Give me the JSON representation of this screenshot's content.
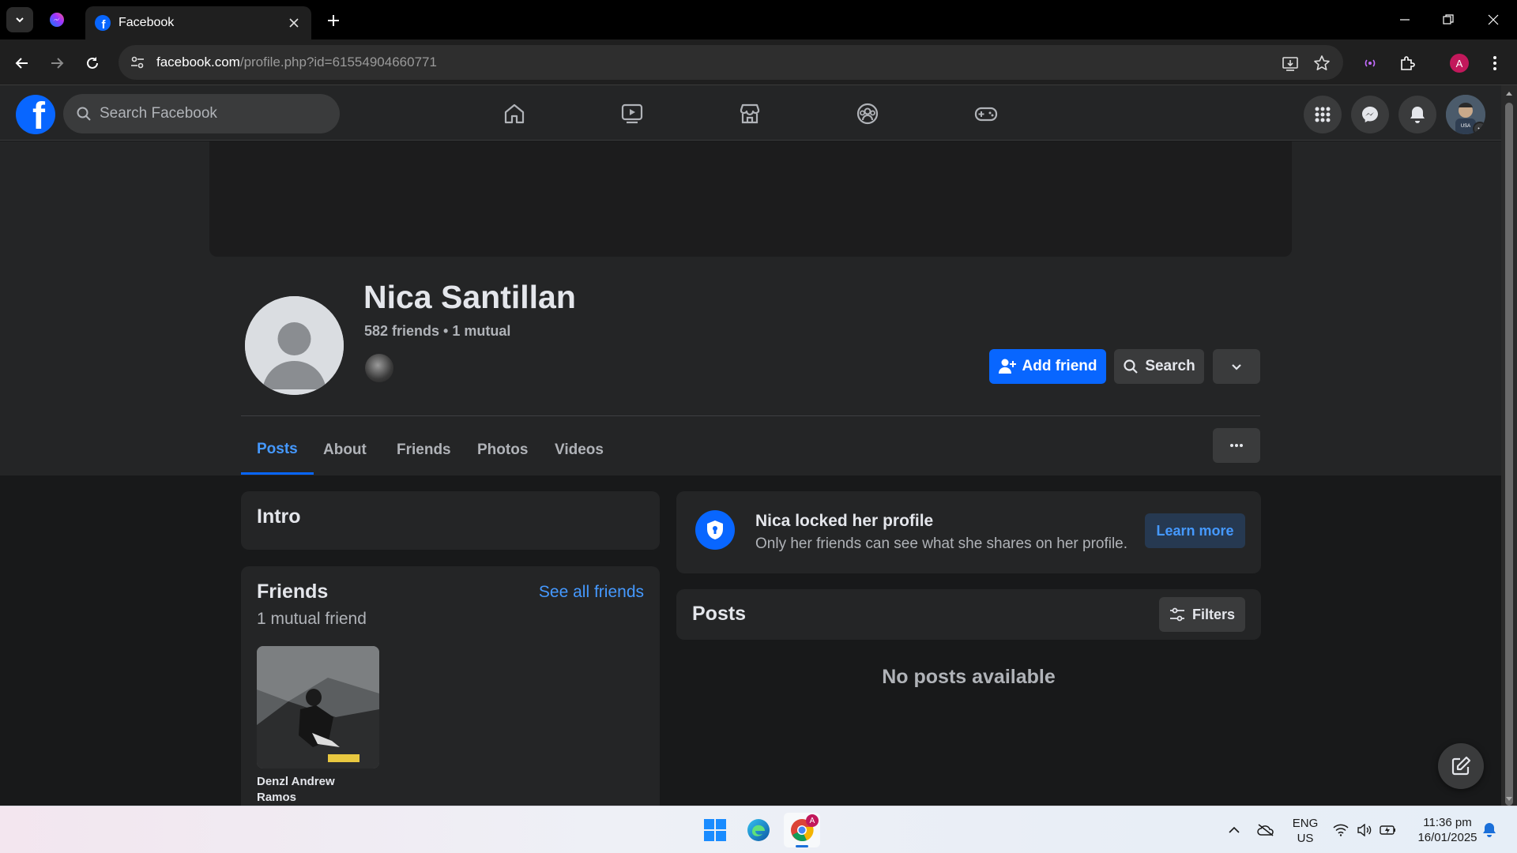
{
  "browser": {
    "tab_title": "Facebook",
    "url_host": "facebook.com",
    "url_path": "/profile.php?id=61554904660771",
    "profile_initial": "A"
  },
  "header": {
    "search_placeholder": "Search Facebook"
  },
  "profile": {
    "name": "Nica Santillan",
    "friend_summary": "582 friends • 1 mutual",
    "add_friend_label": "Add friend",
    "search_label": "Search",
    "tabs": [
      {
        "label": "Posts",
        "active": true
      },
      {
        "label": "About"
      },
      {
        "label": "Friends"
      },
      {
        "label": "Photos"
      },
      {
        "label": "Videos"
      }
    ]
  },
  "intro": {
    "title": "Intro"
  },
  "friends_card": {
    "title": "Friends",
    "see_all": "See all friends",
    "subtitle": "1 mutual friend",
    "friends": [
      {
        "name_line1": "Denzl Andrew",
        "name_line2": "Ramos"
      }
    ]
  },
  "locked": {
    "title": "Nica locked her profile",
    "description": "Only her friends can see what she shares on her profile.",
    "learn_more": "Learn more"
  },
  "posts": {
    "title": "Posts",
    "filters_label": "Filters",
    "empty_message": "No posts available"
  },
  "taskbar": {
    "lang_top": "ENG",
    "lang_bottom": "US",
    "time": "11:36 pm",
    "date": "16/01/2025"
  },
  "colors": {
    "fb_blue": "#0866ff",
    "link_blue": "#4599ff",
    "surface": "#242526",
    "background": "#18191a"
  }
}
